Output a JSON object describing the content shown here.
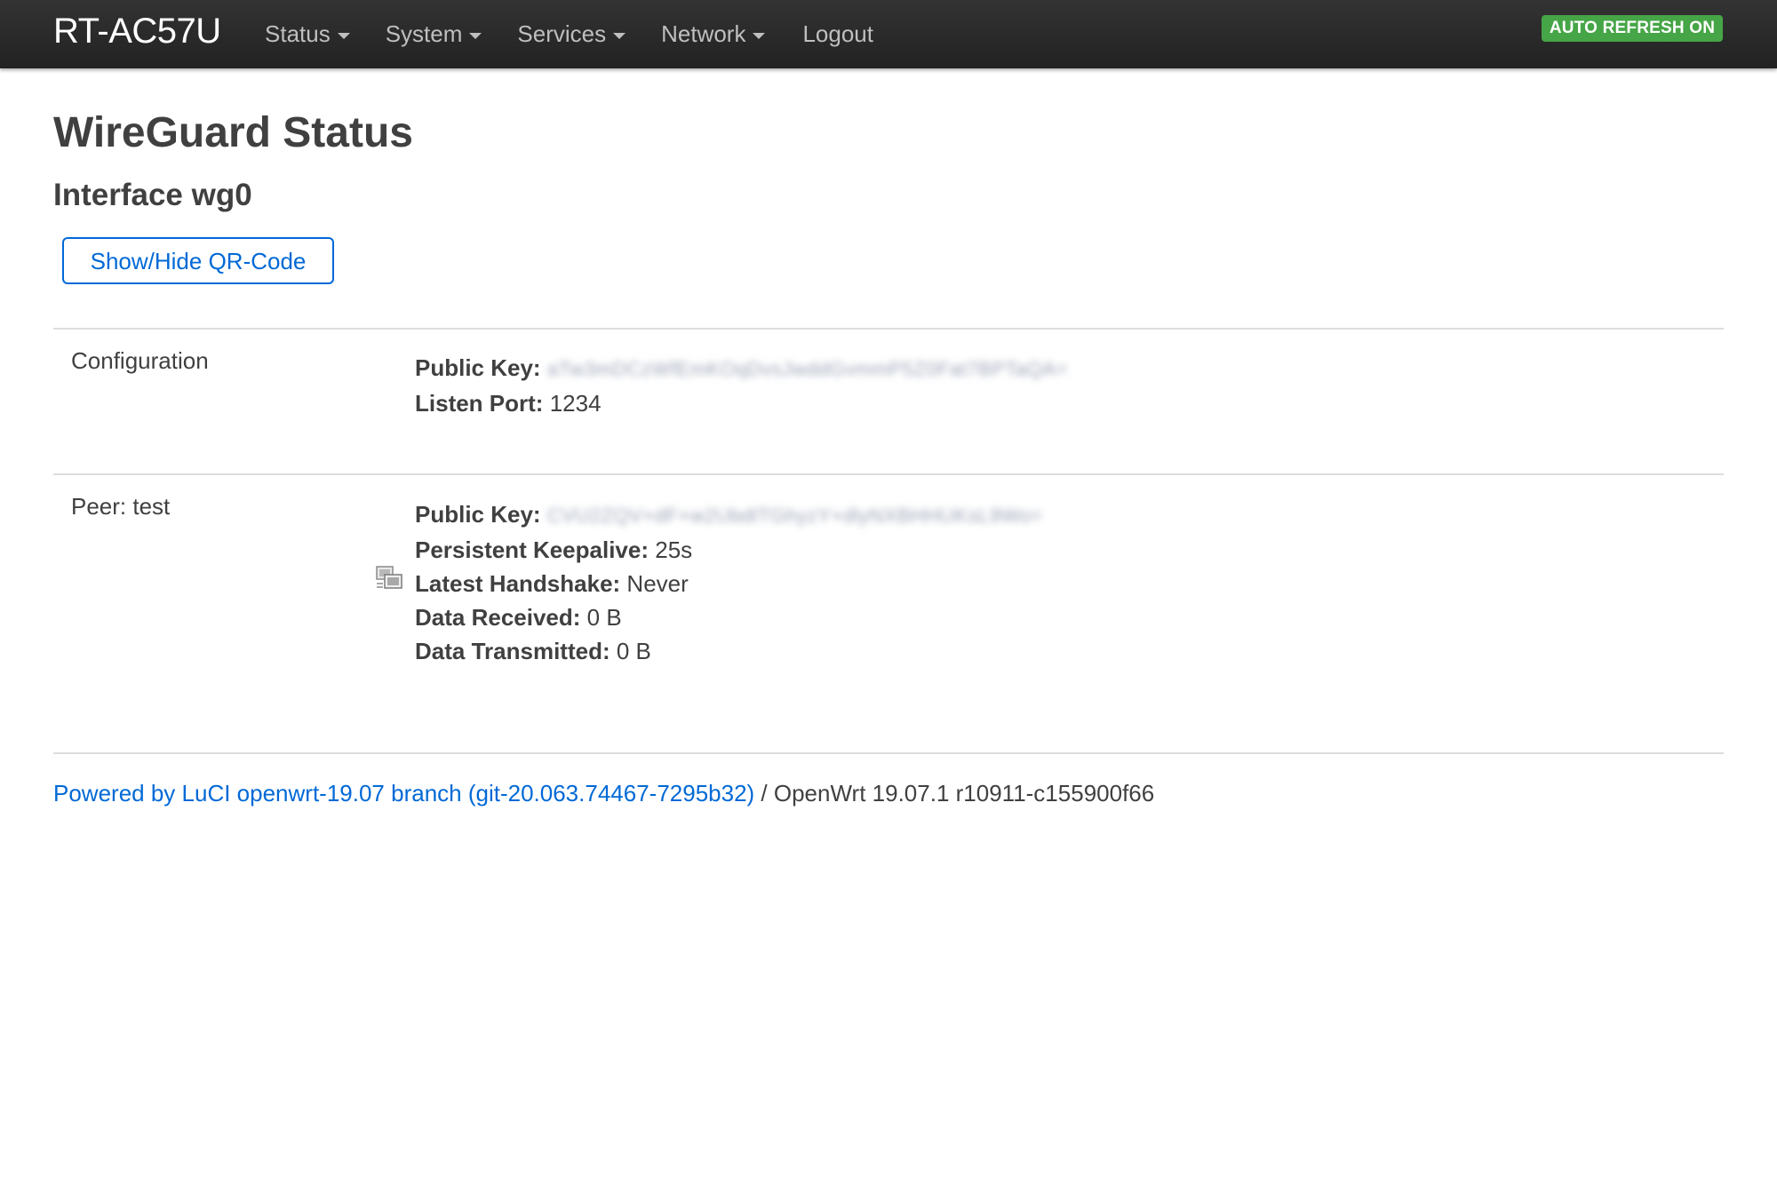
{
  "topbar": {
    "brand": "RT-AC57U",
    "nav": [
      {
        "label": "Status",
        "dropdown": true
      },
      {
        "label": "System",
        "dropdown": true
      },
      {
        "label": "Services",
        "dropdown": true
      },
      {
        "label": "Network",
        "dropdown": true
      },
      {
        "label": "Logout",
        "dropdown": false
      }
    ],
    "refresh_badge": "AUTO REFRESH ON",
    "badge_color": "#46a546"
  },
  "page": {
    "title": "WireGuard Status",
    "interface_title": "Interface wg0",
    "qr_button": "Show/Hide QR-Code"
  },
  "sections": {
    "configuration": {
      "label": "Configuration",
      "public_key_label": "Public Key:",
      "public_key_value": "aTw3mDCzWfEmKOqDvsJwddGvmmP5Z0Fat7BPTaQA=",
      "listen_port_label": "Listen Port:",
      "listen_port_value": "1234"
    },
    "peer": {
      "label": "Peer: test",
      "icon": "peer-network-icon",
      "public_key_label": "Public Key:",
      "public_key_value": "CVU2ZQV+dF+w2UbdlTGhyzY+dlyNXBHHUKsL9Wo=",
      "keepalive_label": "Persistent Keepalive:",
      "keepalive_value": "25s",
      "handshake_label": "Latest Handshake:",
      "handshake_value": "Never",
      "received_label": "Data Received:",
      "received_value": "0 B",
      "transmitted_label": "Data Transmitted:",
      "transmitted_value": "0 B"
    }
  },
  "footer": {
    "link_text": "Powered by LuCI openwrt-19.07 branch (git-20.063.74467-7295b32)",
    "separator": " / ",
    "version_text": "OpenWrt 19.07.1 r10911-c155900f66",
    "link_color": "#0069d6"
  }
}
